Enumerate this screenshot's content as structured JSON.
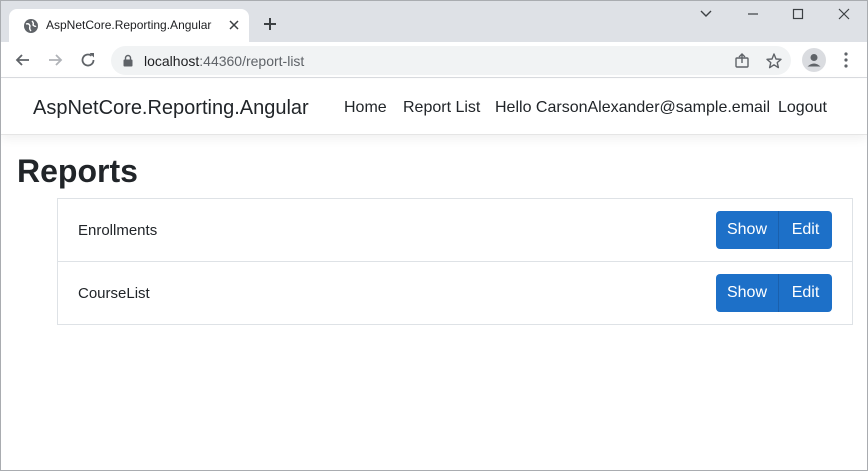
{
  "browser": {
    "tab_title": "AspNetCore.Reporting.Angular",
    "url_host": "localhost",
    "url_rest": ":44360/report-list"
  },
  "site": {
    "brand": "AspNetCore.Reporting.Angular",
    "nav": {
      "home": "Home",
      "report_list": "Report List",
      "greeting": "Hello CarsonAlexander@sample.email",
      "logout": "Logout"
    }
  },
  "main": {
    "title": "Reports",
    "reports": [
      {
        "name": "Enrollments",
        "show_label": "Show",
        "edit_label": "Edit"
      },
      {
        "name": "CourseList",
        "show_label": "Show",
        "edit_label": "Edit"
      }
    ]
  },
  "colors": {
    "accent": "#1d70c8",
    "tabstrip": "#dee1e6"
  }
}
